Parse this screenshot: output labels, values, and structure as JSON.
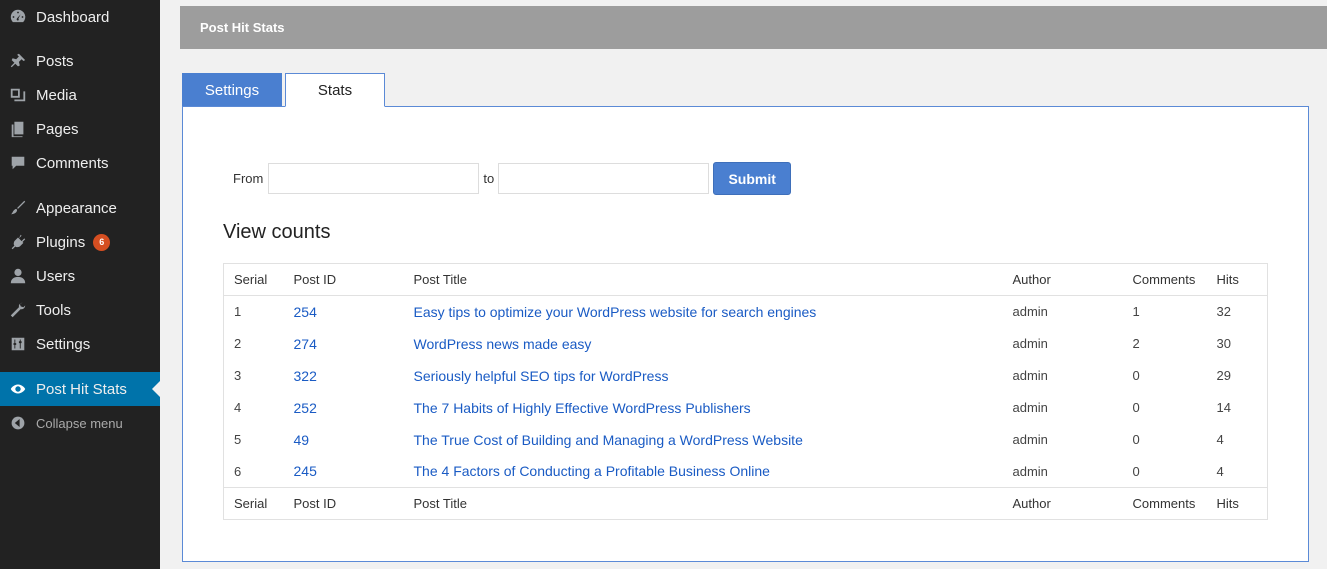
{
  "sidebar": {
    "items": [
      {
        "label": "Dashboard",
        "icon": "dashboard-icon"
      },
      {
        "label": "Posts",
        "icon": "pin-icon"
      },
      {
        "label": "Media",
        "icon": "media-icon"
      },
      {
        "label": "Pages",
        "icon": "pages-icon"
      },
      {
        "label": "Comments",
        "icon": "comment-icon"
      },
      {
        "label": "Appearance",
        "icon": "brush-icon"
      },
      {
        "label": "Plugins",
        "icon": "plugin-icon",
        "badge": "6"
      },
      {
        "label": "Users",
        "icon": "user-icon"
      },
      {
        "label": "Tools",
        "icon": "wrench-icon"
      },
      {
        "label": "Settings",
        "icon": "sliders-icon"
      },
      {
        "label": "Post Hit Stats",
        "icon": "eye-icon",
        "active": true
      }
    ],
    "collapse_label": "Collapse menu"
  },
  "header": {
    "title": "Post Hit Stats"
  },
  "tabs": [
    {
      "label": "Settings",
      "active": false
    },
    {
      "label": "Stats",
      "active": true
    }
  ],
  "filter": {
    "from_label": "From",
    "to_label": "to",
    "from_value": "",
    "to_value": "",
    "submit_label": "Submit"
  },
  "section_title": "View counts",
  "table": {
    "columns": [
      "Serial",
      "Post ID",
      "Post Title",
      "Author",
      "Comments",
      "Hits"
    ],
    "rows": [
      {
        "serial": "1",
        "post_id": "254",
        "title": "Easy tips to optimize your WordPress website for search engines",
        "author": "admin",
        "comments": "1",
        "hits": "32"
      },
      {
        "serial": "2",
        "post_id": "274",
        "title": "WordPress news made easy",
        "author": "admin",
        "comments": "2",
        "hits": "30"
      },
      {
        "serial": "3",
        "post_id": "322",
        "title": "Seriously helpful SEO tips for WordPress",
        "author": "admin",
        "comments": "0",
        "hits": "29"
      },
      {
        "serial": "4",
        "post_id": "252",
        "title": "The 7 Habits of Highly Effective WordPress Publishers",
        "author": "admin",
        "comments": "0",
        "hits": "14"
      },
      {
        "serial": "5",
        "post_id": "49",
        "title": "The True Cost of Building and Managing a WordPress Website",
        "author": "admin",
        "comments": "0",
        "hits": "4"
      },
      {
        "serial": "6",
        "post_id": "245",
        "title": "The 4 Factors of Conducting a Profitable Business Online",
        "author": "admin",
        "comments": "0",
        "hits": "4"
      }
    ]
  },
  "colors": {
    "accent": "#4a7fd0",
    "sidebar": "#222222",
    "active_menu": "#0073aa",
    "link": "#1a5bc4",
    "badge": "#d54e21"
  }
}
